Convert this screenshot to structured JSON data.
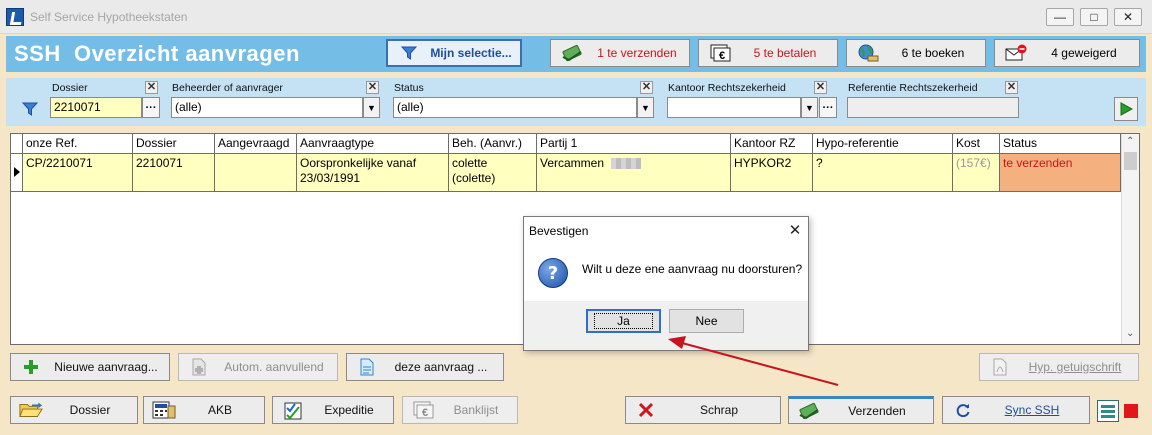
{
  "window": {
    "title": "Self Service Hypotheekstaten"
  },
  "header": {
    "title": "SSH  Overzicht aanvragen",
    "mijn_selectie": "Mijn selectie...",
    "te_verzenden": "1 te verzenden",
    "te_betalen": "5 te betalen",
    "te_boeken": "6 te boeken",
    "geweigerd": "4 geweigerd"
  },
  "filter": {
    "dossier_label": "Dossier",
    "dossier_value": "2210071",
    "beheerder_label": "Beheerder of aanvrager",
    "beheerder_value": "(alle)",
    "status_label": "Status",
    "status_value": "(alle)",
    "kantoor_label": "Kantoor Rechtszekerheid",
    "kantoor_value": "",
    "referentie_label": "Referentie Rechtszekerheid",
    "referentie_value": ""
  },
  "grid": {
    "columns": [
      "onze Ref.",
      "Dossier",
      "Aangevraagd",
      "Aanvraagtype",
      "Beh. (Aanvr.)",
      "Partij 1",
      "Kantoor RZ",
      "Hypo-referentie",
      "Kost",
      "Status"
    ],
    "rows": [
      {
        "ref": "CP/2210071",
        "dossier": "2210071",
        "aangevraagd": "",
        "aanvraagtype": "Oorspronkelijke vanaf 23/03/1991",
        "beh": "colette (colette)",
        "partij": "Vercammen",
        "kantoor": "HYPKOR2",
        "hypo": "?",
        "kost": "(157€)",
        "status": "te verzenden"
      }
    ]
  },
  "actions": {
    "nieuwe": "Nieuwe aanvraag...",
    "autom": "Autom. aanvullend",
    "deze": "deze aanvraag ...",
    "hyp": "Hyp. getuigschrift"
  },
  "footer": {
    "dossier": "Dossier",
    "akb": "AKB",
    "expeditie": "Expeditie",
    "banklijst": "Banklijst",
    "schrap": "Schrap",
    "verzenden": "Verzenden",
    "sync": "Sync SSH"
  },
  "dialog": {
    "title": "Bevestigen",
    "message": "Wilt u deze ene aanvraag nu doorsturen?",
    "yes": "Ja",
    "no": "Nee"
  },
  "colors": {
    "header_bg": "#73bde7",
    "filter_bg": "#c4e2f4",
    "row_bg": "#ffffc0",
    "status_bg": "#f5b07f",
    "status_text": "#c8141e",
    "annotation_arrow": "#c8141e"
  }
}
